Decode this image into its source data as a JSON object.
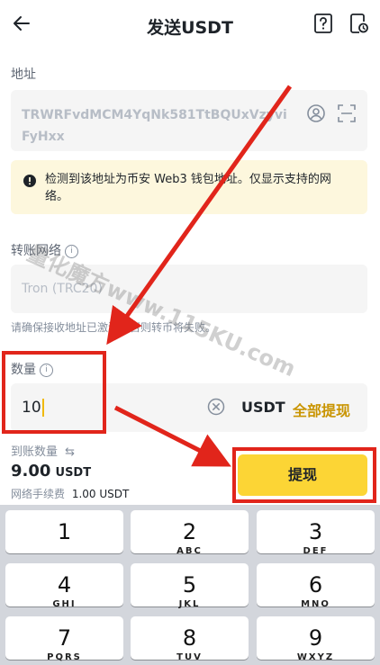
{
  "header": {
    "title": "发送USDT"
  },
  "address": {
    "label": "地址",
    "value": "TRWRFvdMCM4YqNk581TtBQUxVzyviFyHxx"
  },
  "notice": {
    "text": "检测到该地址为币安 Web3 钱包地址。仅显示支持的网络。"
  },
  "network": {
    "label": "转账网络",
    "value": "Tron (TRC20)",
    "hint": "请确保接收地址已激活，否则转币将失败。"
  },
  "amount": {
    "label": "数量",
    "value": "10",
    "unit": "USDT",
    "max_label": "全部提现"
  },
  "receive": {
    "label": "到账数量",
    "amount": "9.00",
    "unit": "USDT",
    "fee_label": "网络手续费",
    "fee_value": "1.00 USDT"
  },
  "withdraw_button": "提现",
  "keypad": [
    {
      "num": "1",
      "letters": ""
    },
    {
      "num": "2",
      "letters": "ABC"
    },
    {
      "num": "3",
      "letters": "DEF"
    },
    {
      "num": "4",
      "letters": "GHI"
    },
    {
      "num": "5",
      "letters": "JKL"
    },
    {
      "num": "6",
      "letters": "MNO"
    },
    {
      "num": "7",
      "letters": "PQRS"
    },
    {
      "num": "8",
      "letters": "TUV"
    },
    {
      "num": "9",
      "letters": "WXYZ"
    }
  ],
  "watermark": {
    "line1": "量化魔方www.115KU.com"
  },
  "colors": {
    "accent": "#fcd535",
    "gold_text": "#c99400",
    "annotation_red": "#e1251b"
  }
}
